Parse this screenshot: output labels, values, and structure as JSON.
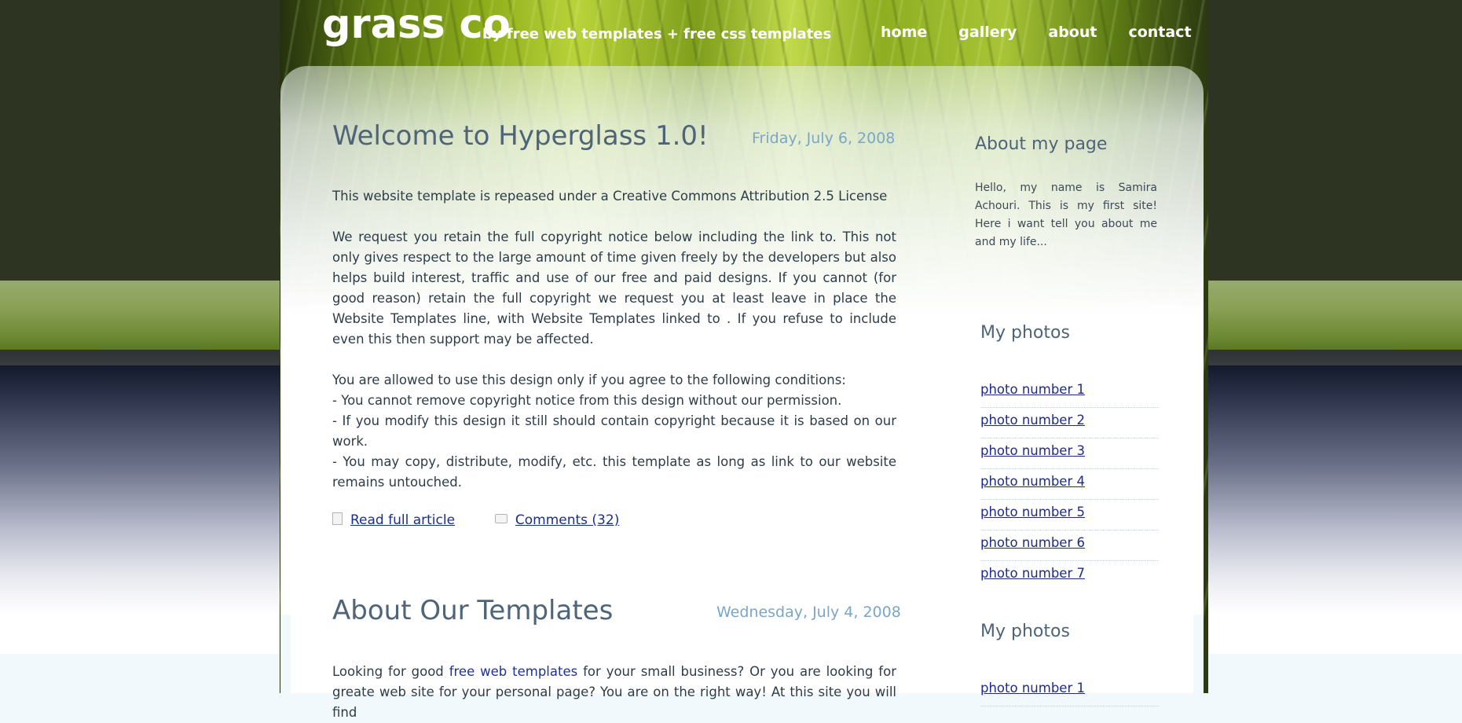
{
  "header": {
    "logo": "grass co",
    "tagline": "by free web templates + free css templates",
    "nav": [
      "home",
      "gallery",
      "about",
      "contact"
    ]
  },
  "posts": [
    {
      "title": "Welcome to Hyperglass 1.0!",
      "date": "Friday, July 6, 2008",
      "paragraphs": [
        [
          "This website template is repeased under a Creative Commons Attribution 2.5 License"
        ],
        [
          "We request you retain the full copyright notice below including the link to. This not only gives respect to the large amount of time given freely by the developers but also helps build interest, traffic and use of our free and paid designs. If you cannot (for good reason) retain the full copyright we request you at least leave in place the Website Templates line, with Website Templates linked to . If you refuse to include even this then support may be affected."
        ],
        [
          "You are allowed to use this design only if you agree to the following conditions:",
          "- You cannot remove copyright notice from this design without our permission.",
          "- If you modify this design it still should contain copyright because it is based on our work.",
          "- You may copy, distribute, modify, etc. this template as long as link to our website remains untouched."
        ]
      ],
      "read_more": "Read full article",
      "comments": "Comments (32)"
    },
    {
      "title": "About Our Templates",
      "date": "Wednesday, July 4, 2008",
      "body_prefix": "Looking for good ",
      "body_link": "free web templates",
      "body_suffix": " for your small business? Or you are looking for greate web site for your personal page? You are on the right way! At this site you will find"
    }
  ],
  "sidebar": {
    "about_heading": "About my page",
    "about_text": "Hello, my name is Samira Achouri. This is my first site! Here i want tell you about me and my life...",
    "photos_heading": "My photos",
    "photos": [
      "photo number 1",
      "photo number 2",
      "photo number 3",
      "photo number 4",
      "photo number 5",
      "photo number 6",
      "photo number 7"
    ],
    "photos_heading_2": "My photos",
    "photos_2": [
      "photo number 1"
    ]
  }
}
